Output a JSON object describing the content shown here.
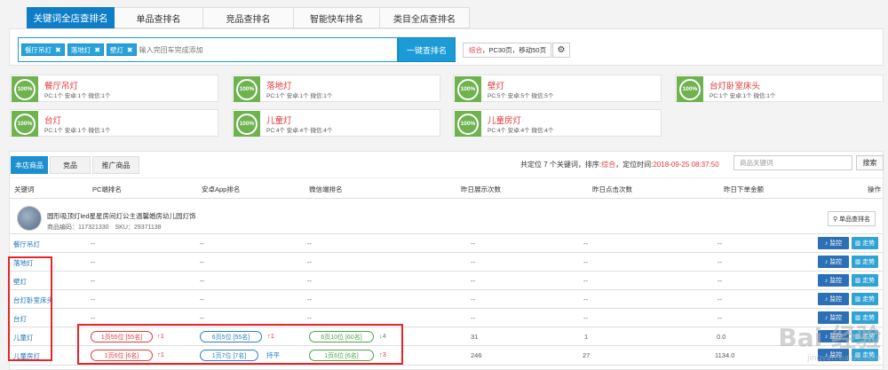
{
  "tabs": [
    "关键词全店查排名",
    "单品查排名",
    "竞品查排名",
    "智能快车排名",
    "类目全店查排名"
  ],
  "search": {
    "chips": [
      "餐厅吊灯",
      "落地灯",
      "壁灯"
    ],
    "chip_close": "✖",
    "placeholder": "输入完回车完成添加",
    "button": "一键查排名",
    "mode_prefix": "综合",
    "mode_rest": "，PC30页，移动50页"
  },
  "cards": [
    {
      "title": "餐厅吊灯",
      "percent": "100%",
      "stats": "PC:1个 安卓:1个 微信:1个"
    },
    {
      "title": "落地灯",
      "percent": "100%",
      "stats": "PC:1个 安卓:1个 微信:1个"
    },
    {
      "title": "壁灯",
      "percent": "100%",
      "stats": "PC:5个 安卓:5个 微信:5个"
    },
    {
      "title": "台灯卧室床头",
      "percent": "100%",
      "stats": "PC:1个 安卓:1个 微信:1个"
    },
    {
      "title": "台灯",
      "percent": "100%",
      "stats": "PC:1个 安卓:1个 微信:1个"
    },
    {
      "title": "儿童灯",
      "percent": "100%",
      "stats": "PC:4个 安卓:4个 微信:4个"
    },
    {
      "title": "儿童房灯",
      "percent": "100%",
      "stats": "PC:4个 安卓:4个 微信:4个"
    }
  ],
  "bottom_tabs": [
    "本店商品",
    "竞品",
    "推广商品"
  ],
  "info": {
    "prefix": "共定位 7 个关键词，排序:",
    "sort": "综合",
    "mid": "，定位时间:",
    "time": "2018-09-25 08:37:50"
  },
  "keyword_placeholder": "商品关键词",
  "find_button": "搜索",
  "columns": [
    "关键词",
    "PC端排名",
    "安卓App排名",
    "微信端排名",
    "昨日展示次数",
    "昨日点击次数",
    "昨日下单金额",
    "操作"
  ],
  "product": {
    "title": "圆形吸顶灯led星星房间灯公主温馨婚房幼儿园灯饰",
    "code": "商品编码：117321330　SKU：29371138",
    "rank_button": "单品查排名"
  },
  "actions": {
    "monitor": "监控",
    "trend": "走势"
  },
  "rows": [
    {
      "keyword": "餐厅吊灯",
      "pc": "--",
      "android": "--",
      "wechat": "--",
      "show": "--",
      "click": "--",
      "amount": "--"
    },
    {
      "keyword": "落地灯",
      "pc": "--",
      "android": "--",
      "wechat": "--",
      "show": "--",
      "click": "--",
      "amount": "--"
    },
    {
      "keyword": "壁灯",
      "pc": "--",
      "android": "--",
      "wechat": "--",
      "show": "--",
      "click": "--",
      "amount": "--"
    },
    {
      "keyword": "台灯卧室床头",
      "pc": "--",
      "android": "--",
      "wechat": "--",
      "show": "--",
      "click": "--",
      "amount": "--"
    },
    {
      "keyword": "台灯",
      "pc": "--",
      "android": "--",
      "wechat": "--",
      "show": "--",
      "click": "--",
      "amount": "--"
    },
    {
      "keyword": "儿童灯",
      "pc": "1页55位 [55名]",
      "pc_chg": "↑1",
      "android": "6页5位 [55名]",
      "android_chg": "↑1",
      "wechat": "6页10位 [60名]",
      "wechat_chg": "↓4",
      "show": "31",
      "click": "1",
      "amount": "0.0"
    },
    {
      "keyword": "儿童房灯",
      "pc": "1页6位 [6名]",
      "pc_chg": "↑1",
      "android": "1页7位 [7名]",
      "android_chg": "持平",
      "wechat": "1页6位 [6名]",
      "wechat_chg": "↑3",
      "show": "246",
      "click": "27",
      "amount": "1134.0"
    }
  ],
  "watermark": {
    "main": "Bai 经验",
    "sub": "jingyan.baidu.com"
  },
  "colors": {
    "primary": "#0e7ec8",
    "accent_red": "#e4393c",
    "progress_green": "#6fb24f",
    "highlight_box": "#e5252a"
  }
}
